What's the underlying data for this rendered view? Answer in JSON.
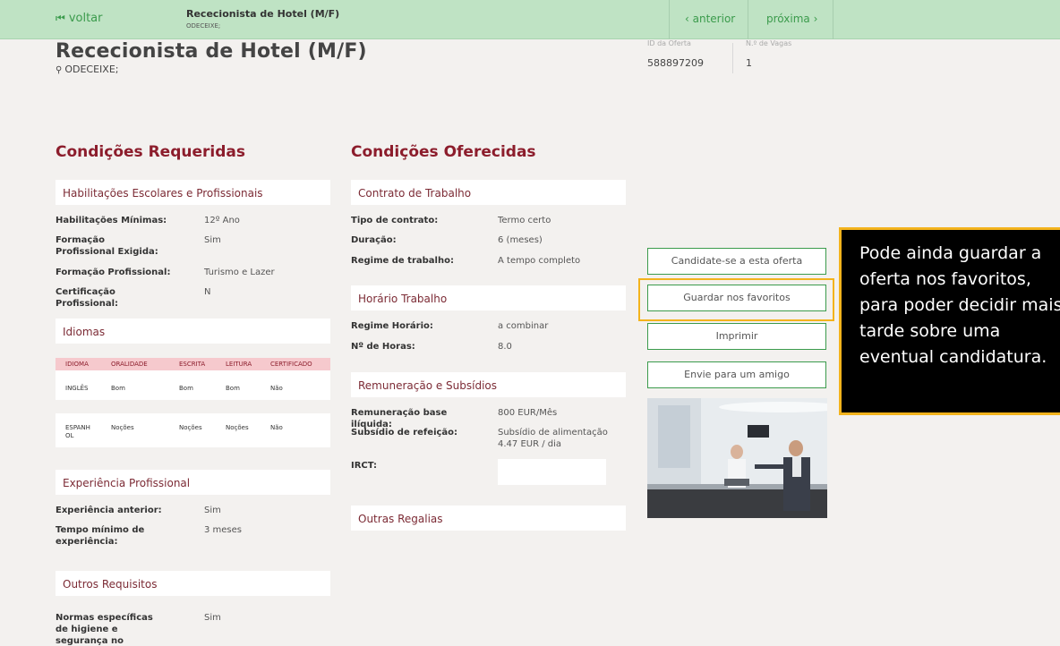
{
  "topbar": {
    "back_label": "voltar",
    "title": "Rececionista de Hotel (M/F)",
    "location": "ODECEIXE;",
    "prev_label": "anterior",
    "next_label": "próxima"
  },
  "header": {
    "title": "Rececionista de Hotel (M/F)",
    "location": "ODECEIXE;",
    "offer_id_label": "ID da Oferta",
    "offer_id": "588897209",
    "vacancies_label": "N.º de Vagas",
    "vacancies": "1"
  },
  "required": {
    "heading": "Condições Requeridas",
    "education_box": "Habilitações Escolares e Profissionais",
    "education": [
      {
        "k": "Habilitações Mínimas:",
        "v": "12º Ano"
      },
      {
        "k": "Formação Profissional Exigida:",
        "v": "Sim"
      },
      {
        "k": "Formação Profissional:",
        "v": "Turismo e Lazer"
      },
      {
        "k": "Certificação Profissional:",
        "v": "N"
      }
    ],
    "languages_box": "Idiomas",
    "lang_headers": [
      "IDIOMA",
      "ORALIDADE",
      "ESCRITA",
      "LEITURA",
      "CERTIFICADO"
    ],
    "languages": [
      [
        "INGLÊS",
        "Bom",
        "Bom",
        "Bom",
        "Não"
      ],
      [
        "ESPANHOL",
        "Noções",
        "Noções",
        "Noções",
        "Não"
      ]
    ],
    "experience_box": "Experiência Profissional",
    "experience": [
      {
        "k": "Experiência anterior:",
        "v": "Sim"
      },
      {
        "k": "Tempo mínimo de experiência:",
        "v": "3 meses"
      }
    ],
    "other_box": "Outros Requisitos",
    "other": [
      {
        "k": "Normas específicas de higiene e segurança no trabalho:",
        "v": "Sim"
      }
    ]
  },
  "offered": {
    "heading": "Condições Oferecidas",
    "contract_box": "Contrato de Trabalho",
    "contract": [
      {
        "k": "Tipo de contrato:",
        "v": "Termo certo"
      },
      {
        "k": "Duração:",
        "v": "6 (meses)"
      },
      {
        "k": "Regime de trabalho:",
        "v": "A tempo completo"
      }
    ],
    "schedule_box": "Horário Trabalho",
    "schedule": [
      {
        "k": "Regime Horário:",
        "v": "a combinar"
      },
      {
        "k": "Nº de Horas:",
        "v": "8.0"
      }
    ],
    "pay_box": "Remuneração e Subsídios",
    "pay": [
      {
        "k": "Remuneração base ilíquida:",
        "v": "800 EUR/Mês"
      },
      {
        "k": "Subsídio de refeição:",
        "v": "Subsídio de alimentação 4.47 EUR / dia"
      },
      {
        "k": "IRCT:",
        "v": ""
      }
    ],
    "perks_box": "Outras Regalias"
  },
  "actions": {
    "apply": "Candidate-se a esta oferta",
    "save": "Guardar nos favoritos",
    "print": "Imprimir",
    "send": "Envie para um amigo"
  },
  "callout": {
    "text": "Pode ainda guardar a\noferta nos favoritos,\npara poder decidir mais\ntarde sobre uma\neventual candidatura."
  },
  "colors": {
    "accent_green": "#3b9b4c",
    "topbar_bg": "#bfe3c4",
    "heading_red": "#8c1d2c",
    "highlight": "#f3b31c"
  }
}
